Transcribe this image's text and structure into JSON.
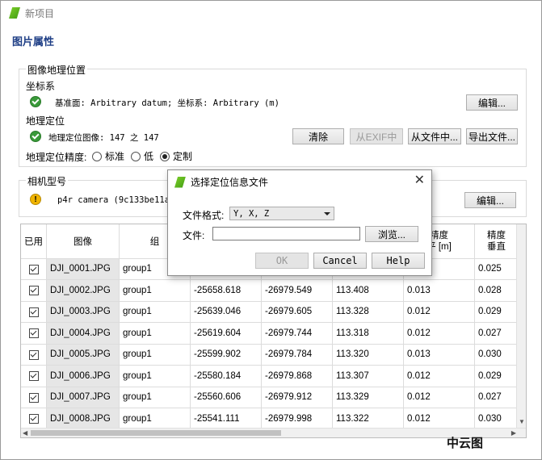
{
  "window": {
    "title": "新项目"
  },
  "page_title": "图片属性",
  "geo": {
    "section_title": "图像地理位置",
    "coord_label": "坐标系",
    "coord_value": "基准面: Arbitrary datum; 坐标系: Arbitrary (m)",
    "coord_edit_button": "编辑...",
    "geoloc_label": "地理定位",
    "geoloc_value": "地理定位图像: 147 之 147",
    "buttons": {
      "clear": "清除",
      "from_exif": "从EXIF中",
      "from_file": "从文件中...",
      "export": "导出文件..."
    },
    "accuracy_label": "地理定位精度:",
    "accuracy_options": [
      "标准",
      "低",
      "定制"
    ],
    "accuracy_selected": "定制"
  },
  "camera": {
    "section_title": "相机型号",
    "value": "p4r camera (9c133be11a98fd",
    "edit_button": "编辑..."
  },
  "table": {
    "headers": [
      "已用",
      "图像",
      "组",
      "",
      "",
      "",
      "精度\n平 [m]",
      "精度\n垂直"
    ],
    "rows": [
      {
        "enabled": true,
        "image": "DJI_0001.JPG",
        "group": "group1",
        "x": "",
        "y": "",
        "z": "",
        "acc_h": "",
        "acc_v": "0.025"
      },
      {
        "enabled": true,
        "image": "DJI_0002.JPG",
        "group": "group1",
        "x": "-25658.618",
        "y": "-26979.549",
        "z": "113.408",
        "acc_h": "0.013",
        "acc_v": "0.028"
      },
      {
        "enabled": true,
        "image": "DJI_0003.JPG",
        "group": "group1",
        "x": "-25639.046",
        "y": "-26979.605",
        "z": "113.328",
        "acc_h": "0.012",
        "acc_v": "0.029"
      },
      {
        "enabled": true,
        "image": "DJI_0004.JPG",
        "group": "group1",
        "x": "-25619.604",
        "y": "-26979.744",
        "z": "113.318",
        "acc_h": "0.012",
        "acc_v": "0.027"
      },
      {
        "enabled": true,
        "image": "DJI_0005.JPG",
        "group": "group1",
        "x": "-25599.902",
        "y": "-26979.784",
        "z": "113.320",
        "acc_h": "0.013",
        "acc_v": "0.030"
      },
      {
        "enabled": true,
        "image": "DJI_0006.JPG",
        "group": "group1",
        "x": "-25580.184",
        "y": "-26979.868",
        "z": "113.307",
        "acc_h": "0.012",
        "acc_v": "0.029"
      },
      {
        "enabled": true,
        "image": "DJI_0007.JPG",
        "group": "group1",
        "x": "-25560.606",
        "y": "-26979.912",
        "z": "113.329",
        "acc_h": "0.012",
        "acc_v": "0.027"
      },
      {
        "enabled": true,
        "image": "DJI_0008.JPG",
        "group": "group1",
        "x": "-25541.111",
        "y": "-26979.998",
        "z": "113.322",
        "acc_h": "0.012",
        "acc_v": "0.030"
      }
    ]
  },
  "dialog": {
    "title": "选择定位信息文件",
    "format_label": "文件格式:",
    "format_value": "Y, X, Z",
    "file_label": "文件:",
    "file_value": "",
    "browse_button": "浏览...",
    "ok_button": "OK",
    "cancel_button": "Cancel",
    "help_button": "Help"
  },
  "watermark": "中云图",
  "colors": {
    "accent": "#1f3f86",
    "ok": "#3a9a3a",
    "warn": "#f0b400"
  }
}
